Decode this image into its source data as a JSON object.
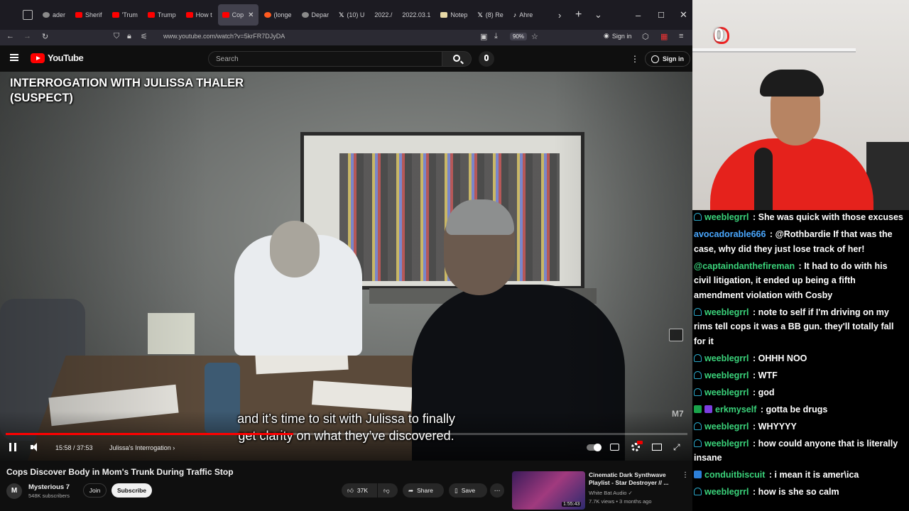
{
  "browser": {
    "tabs": [
      {
        "label": "ader",
        "favicon": "stack-icon",
        "active": false
      },
      {
        "label": "Sherif",
        "favicon": "youtube",
        "active": false
      },
      {
        "label": "'Trum",
        "favicon": "youtube",
        "active": false
      },
      {
        "label": "Trump",
        "favicon": "youtube",
        "active": false
      },
      {
        "label": "How t",
        "favicon": "youtube",
        "active": false
      },
      {
        "label": "Cop",
        "favicon": "youtube",
        "active": true
      },
      {
        "label": "(longe",
        "favicon": "reddit",
        "active": false
      },
      {
        "label": "Depar",
        "favicon": "seal",
        "active": false
      },
      {
        "label": "(10) U",
        "favicon": "x",
        "active": false
      },
      {
        "label": "2022./",
        "favicon": "none",
        "active": false
      },
      {
        "label": "2022.03.1",
        "favicon": "none",
        "active": false
      },
      {
        "label": "Notep",
        "favicon": "note",
        "active": false
      },
      {
        "label": "(8) Re",
        "favicon": "x",
        "active": false
      },
      {
        "label": "Ahre",
        "favicon": "tiktok",
        "active": false
      }
    ],
    "url": "www.youtube.com/watch?v=5krFR7DJyDA",
    "zoom": "90%",
    "signin_label": "Sign in"
  },
  "youtube": {
    "logo_text": "YouTube",
    "search_placeholder": "Search",
    "signin_label": "Sign in"
  },
  "video": {
    "overlay_title_line1": "INTERROGATION WITH JULISSA THALER",
    "overlay_title_line2": "(SUSPECT)",
    "subtitle_line1": "and it’s time to sit with Julissa to finally",
    "subtitle_line2": "get clarity on what they’ve discovered.",
    "watermark": "M7",
    "current_time": "15:58",
    "duration": "37:53",
    "time_display": "15:58 / 37:53",
    "progress_fraction": 0.4215,
    "chapter": "Julissa's Interrogation"
  },
  "info": {
    "title": "Cops Discover Body in Mom's Trunk During Traffic Stop",
    "channel": "Mysterious 7",
    "channel_initials": "M",
    "subscribers": "548K subscribers",
    "join_label": "Join",
    "subscribe_label": "Subscribe",
    "likes": "37K",
    "share_label": "Share",
    "save_label": "Save"
  },
  "recommended": {
    "title": "Cinematic Dark Synthwave Playlist - Star Destroyer // ...",
    "channel": "White Bat Audio",
    "meta": "7.7K views • 3 months ago",
    "duration": "1:55:43"
  },
  "webcam": {
    "counter": "0"
  },
  "chat": [
    {
      "badge": "person",
      "user": "weeblegrrl",
      "color": "#3ad27a",
      "text": "She was quick with those excuses"
    },
    {
      "badge": "none",
      "user": "avocadorable666",
      "color": "#4aa8ff",
      "text": "@Rothbardie If that was the case, why did they just lose track of her!"
    },
    {
      "badge": "none",
      "user": "@captaindanthefireman",
      "color": "#3ad27a",
      "text": "It had to do with his civil litigation, it ended up being a fifth amendment violation with Cosby"
    },
    {
      "badge": "person",
      "user": "weeblegrrl",
      "color": "#3ad27a",
      "text": "note to self if I'm driving on my rims tell cops it was a BB gun. they'll totally fall for it"
    },
    {
      "badge": "person",
      "user": "weeblegrrl",
      "color": "#3ad27a",
      "text": "OHHH NOO"
    },
    {
      "badge": "person",
      "user": "weeblegrrl",
      "color": "#3ad27a",
      "text": "WTF"
    },
    {
      "badge": "person",
      "user": "weeblegrrl",
      "color": "#3ad27a",
      "text": "god"
    },
    {
      "badge": "mod-sub",
      "user": "erkmyself",
      "color": "#3ad27a",
      "text": "gotta be drugs"
    },
    {
      "badge": "person",
      "user": "weeblegrrl",
      "color": "#3ad27a",
      "text": "WHYYYY"
    },
    {
      "badge": "person",
      "user": "weeblegrrl",
      "color": "#3ad27a",
      "text": "how could anyone that is literally insane"
    },
    {
      "badge": "vip",
      "user": "conduitbiscuit",
      "color": "#3ad27a",
      "text": "i mean it is amer\\ica"
    },
    {
      "badge": "person",
      "user": "weeblegrrl",
      "color": "#3ad27a",
      "text": "how is she so calm"
    }
  ]
}
